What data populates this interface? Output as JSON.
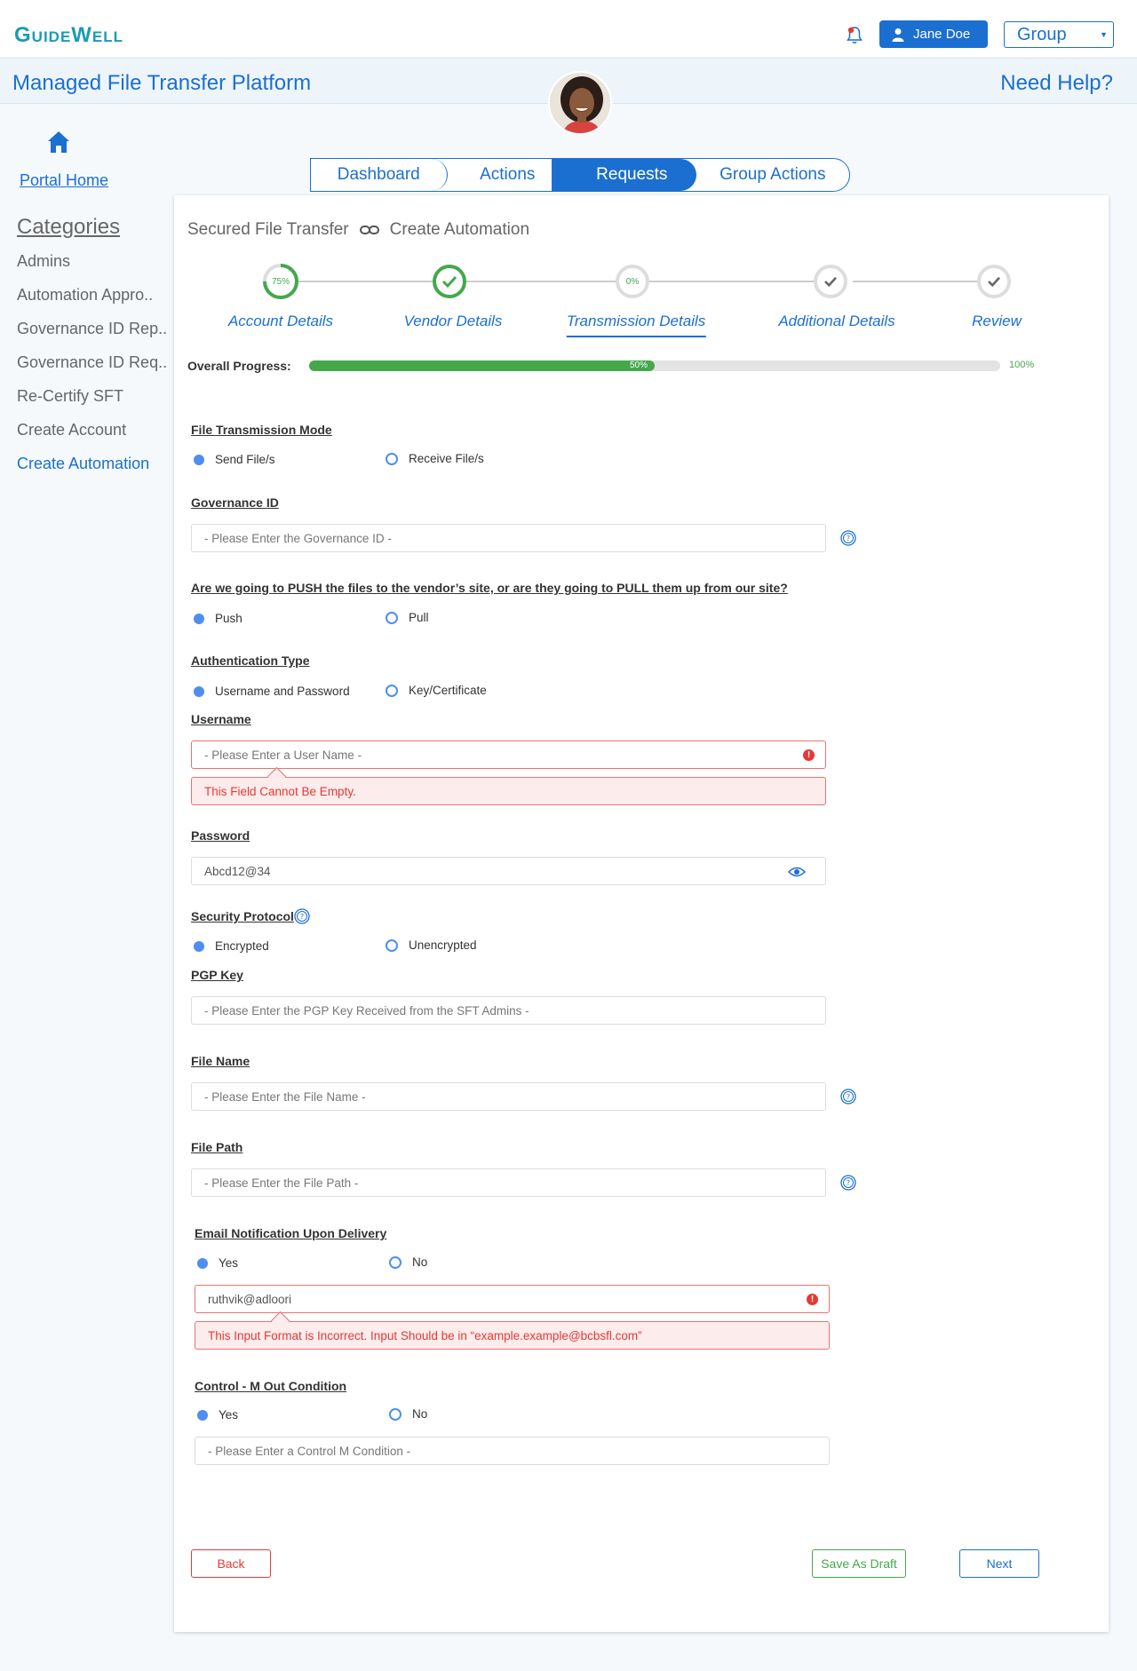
{
  "header": {
    "logo": "GuideWell",
    "user_label": "Jane Doe",
    "group_label": "Group",
    "app_title": "Managed File Transfer Platform",
    "help_label": "Need Help?"
  },
  "sidebar": {
    "home_label": "Portal Home",
    "categories_title": "Categories",
    "items": [
      {
        "label": "Admins"
      },
      {
        "label": "Automation Appro.."
      },
      {
        "label": "Governance ID Rep.."
      },
      {
        "label": "Governance ID Req.."
      },
      {
        "label": "Re-Certify SFT"
      },
      {
        "label": "Create Account"
      },
      {
        "label": "Create Automation"
      }
    ]
  },
  "nav": {
    "tabs": [
      {
        "label": "Dashboard"
      },
      {
        "label": "Actions"
      },
      {
        "label": "Requests"
      },
      {
        "label": "Group Actions"
      }
    ],
    "active_tab": "Requests"
  },
  "breadcrumb": {
    "parent": "Secured File Transfer",
    "current": "Create Automation"
  },
  "stepper": {
    "steps": [
      {
        "label": "Account Details",
        "badge": "75%",
        "progress": 0.75
      },
      {
        "label": "Vendor Details"
      },
      {
        "label": "Transmission Details",
        "badge": "0%",
        "progress": 0
      },
      {
        "label": "Additional Details"
      },
      {
        "label": "Review"
      }
    ],
    "active_step": "Transmission Details"
  },
  "overall_progress": {
    "label": "Overall Progress:",
    "value_label": "50%",
    "value": 0.5,
    "max_label": "100%"
  },
  "form": {
    "transmission_mode": {
      "label": "File Transmission Mode",
      "options": [
        "Send File/s",
        "Receive File/s"
      ],
      "selected": "Send File/s"
    },
    "governance_id": {
      "label": "Governance ID",
      "placeholder": "- Please Enter the Governance ID -"
    },
    "push_pull": {
      "label": "Are we going to PUSH the files to the vendor’s site, or are they going to PULL them up from our site?",
      "options": [
        "Push",
        "Pull"
      ],
      "selected": "Push"
    },
    "auth_type": {
      "label": "Authentication Type",
      "options": [
        "Username and Password",
        "Key/Certificate"
      ],
      "selected": "Username and Password"
    },
    "username": {
      "label": "Username",
      "placeholder": "- Please Enter a User  Name -",
      "error": "This Field Cannot Be Empty."
    },
    "password": {
      "label": "Password",
      "value": "Abcd12@34"
    },
    "security_protocol": {
      "label": "Security Protocol",
      "options": [
        "Encrypted",
        "Unencrypted"
      ],
      "selected": "Encrypted"
    },
    "pgp_key": {
      "label": "PGP Key",
      "placeholder": "- Please Enter the PGP Key Received from the SFT Admins -"
    },
    "file_name": {
      "label": "File Name",
      "placeholder": "- Please Enter the File Name -"
    },
    "file_path": {
      "label": "File Path",
      "placeholder": "- Please Enter the File Path -"
    },
    "email_notification": {
      "label": "Email Notification Upon Delivery",
      "options": [
        "Yes",
        "No"
      ],
      "selected": "Yes",
      "value": "ruthvik@adloori",
      "error": "This Input Format is Incorrect. Input Should be in “example.example@bcbsfl.com”"
    },
    "control_m": {
      "label": "Control - M Out Condition",
      "options": [
        "Yes",
        "No"
      ],
      "selected": "Yes",
      "placeholder": "- Please Enter a Control M Condition  -"
    }
  },
  "buttons": {
    "back": "Back",
    "save_draft": "Save As Draft",
    "next": "Next"
  },
  "colors": {
    "primary": "#1b6fd0",
    "success": "#43a84c",
    "error": "#e53935",
    "logo": "#1a9bb7"
  }
}
